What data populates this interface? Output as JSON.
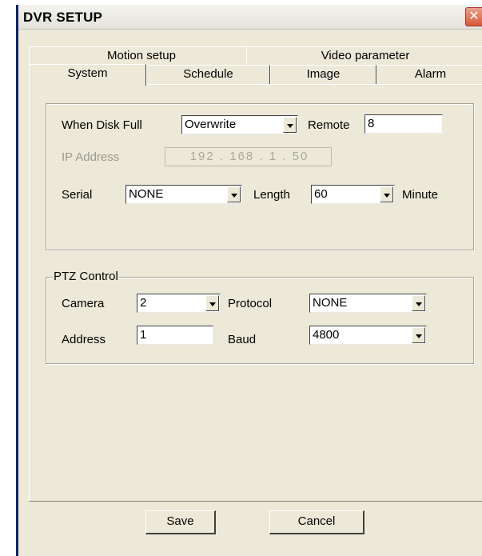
{
  "window": {
    "title": "DVR SETUP",
    "close_symbol": "✕"
  },
  "tabs": {
    "back_row": [
      "Motion setup",
      "Video parameter"
    ],
    "front_row": [
      "System",
      "Schedule",
      "Image",
      "Alarm"
    ],
    "active": "System"
  },
  "system": {
    "disk_full_label": "When Disk Full",
    "disk_full_value": "Overwrite",
    "remote_label": "Remote",
    "remote_value": "8",
    "ip_label": "IP Address",
    "ip_value": "192 . 168 .  1  .  50",
    "serial_label": "Serial",
    "serial_value": "NONE",
    "length_label": "Length",
    "length_value": "60",
    "minute_label": "Minute"
  },
  "ptz": {
    "group_label": "PTZ Control",
    "camera_label": "Camera",
    "camera_value": "2",
    "protocol_label": "Protocol",
    "protocol_value": "NONE",
    "address_label": "Address",
    "address_value": "1",
    "baud_label": "Baud",
    "baud_value": "4800"
  },
  "buttons": {
    "save": "Save",
    "cancel": "Cancel"
  },
  "colors": {
    "window_bg": "#ece9d8",
    "close_button": "#d65a3a"
  }
}
